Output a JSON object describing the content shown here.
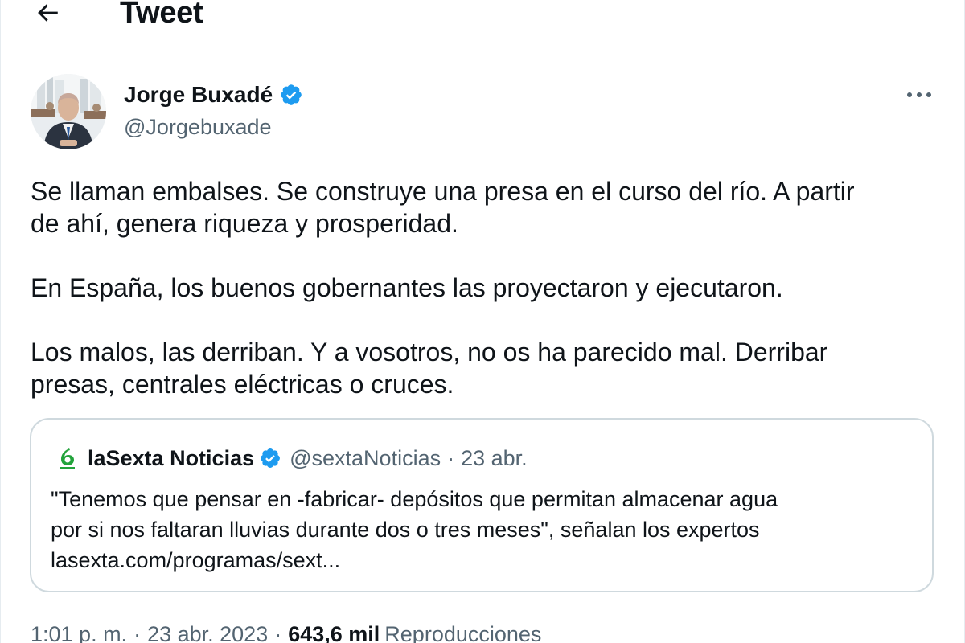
{
  "header": {
    "title": "Tweet",
    "back_icon": "arrow-left-icon"
  },
  "author": {
    "name": "Jorge Buxadé",
    "handle": "@Jorgebuxade",
    "verified_color": "#1d9bf0"
  },
  "tweet": {
    "paragraphs": [
      "Se llaman embalses. Se construye una presa en el curso del río. A partir\nde ahí, genera riqueza y prosperidad.",
      "En España, los buenos gobernantes las proyectaron y ejecutaron.",
      "Los malos, las derriban. Y a vosotros, no os ha parecido mal. Derribar\npresas, centrales eléctricas o cruces."
    ]
  },
  "quote": {
    "name": "laSexta Noticias",
    "handle": "@sextaNoticias",
    "separator": "·",
    "date": "23 abr.",
    "lines": [
      "\"Tenemos que pensar en -fabricar- depósitos que permitan almacenar agua",
      "por si nos faltaran lluvias durante dos o tres meses\", señalan los expertos",
      "lasexta.com/programas/sext..."
    ],
    "logo_color": "#22a33b"
  },
  "meta": {
    "time": "1:01 p. m.",
    "separator": "·",
    "date": "23 abr. 2023",
    "views_count": "643,6 mil",
    "views_label": "Reproducciones"
  },
  "colors": {
    "text_primary": "#0f1419",
    "text_secondary": "#536471",
    "border": "#cfd9de",
    "verified": "#1d9bf0"
  }
}
